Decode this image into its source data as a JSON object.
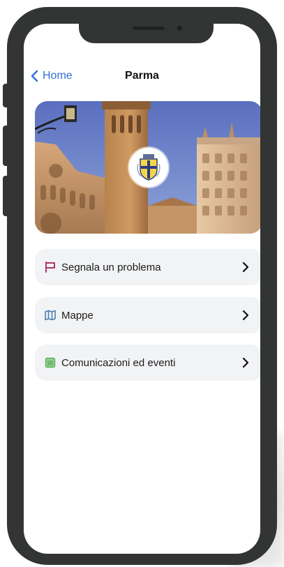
{
  "nav": {
    "back_label": "Home",
    "title": "Parma"
  },
  "menu": {
    "items": [
      {
        "label": "Segnala un problema",
        "icon": "flag-icon",
        "icon_color": "#b0336a"
      },
      {
        "label": "Mappe",
        "icon": "map-icon",
        "icon_color": "#4a7fb0"
      },
      {
        "label": "Comunicazioni ed eventi",
        "icon": "calendar-icon",
        "icon_color": "#5fae5f"
      }
    ]
  },
  "colors": {
    "accent": "#2f6fd6",
    "frame": "#333434",
    "card": "#f2f3f5"
  }
}
